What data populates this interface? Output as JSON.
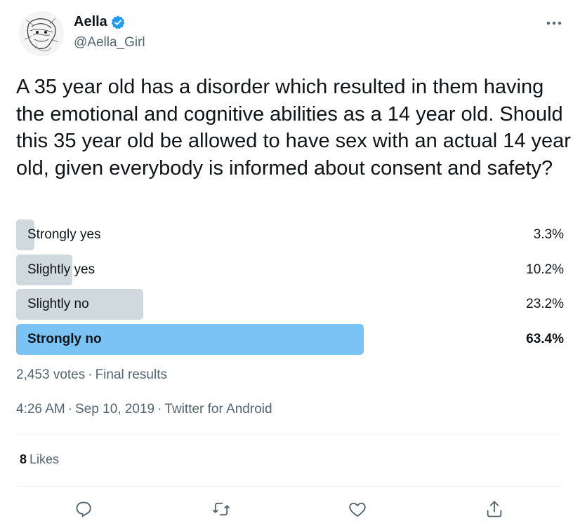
{
  "author": {
    "display_name": "Aella",
    "handle": "@Aella_Girl",
    "verified": true
  },
  "tweet": {
    "text": "A 35 year old has a disorder which resulted in them having the emotional and cognitive abilities as a 14 year old. Should this 35 year old be allowed to have sex with an actual 14 year old, given everybody is informed about consent and safety?"
  },
  "poll": {
    "options": [
      {
        "label": "Strongly yes",
        "percent_text": "3.3%",
        "percent": 3.3,
        "winner": false
      },
      {
        "label": "Slightly yes",
        "percent_text": "10.2%",
        "percent": 10.2,
        "winner": false
      },
      {
        "label": "Slightly no",
        "percent_text": "23.2%",
        "percent": 23.2,
        "winner": false
      },
      {
        "label": "Strongly no",
        "percent_text": "63.4%",
        "percent": 63.4,
        "winner": true
      }
    ],
    "votes": "2,453 votes",
    "status": "Final results"
  },
  "meta": {
    "time": "4:26 AM",
    "date": "Sep 10, 2019",
    "source": "Twitter for Android",
    "separator": "·"
  },
  "stats": {
    "likes_count": "8",
    "likes_label": "Likes"
  },
  "icons": {
    "more": "more-horizontal-icon",
    "verified": "verified-badge-icon",
    "reply": "reply-icon",
    "retweet": "retweet-icon",
    "like": "heart-icon",
    "share": "share-icon"
  },
  "colors": {
    "accent": "#1d9bf0",
    "winner_bar": "#7cc3f5",
    "bar": "#cfd9de",
    "secondary_text": "#536471"
  }
}
